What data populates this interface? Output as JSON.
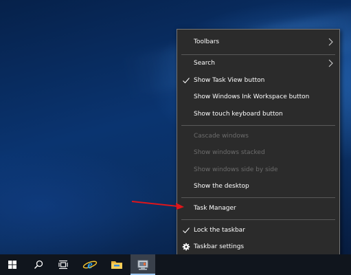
{
  "context_menu": {
    "items": [
      {
        "label": "Toolbars",
        "enabled": true,
        "checked": false,
        "submenu": true
      },
      {
        "label": "Search",
        "enabled": true,
        "checked": false,
        "submenu": true
      },
      {
        "label": "Show Task View button",
        "enabled": true,
        "checked": true
      },
      {
        "label": "Show Windows Ink Workspace button",
        "enabled": true,
        "checked": false
      },
      {
        "label": "Show touch keyboard button",
        "enabled": true,
        "checked": false
      },
      {
        "label": "Cascade windows",
        "enabled": false,
        "checked": false
      },
      {
        "label": "Show windows stacked",
        "enabled": false,
        "checked": false
      },
      {
        "label": "Show windows side by side",
        "enabled": false,
        "checked": false
      },
      {
        "label": "Show the desktop",
        "enabled": true,
        "checked": false
      },
      {
        "label": "Task Manager",
        "enabled": true,
        "checked": false
      },
      {
        "label": "Lock the taskbar",
        "enabled": true,
        "checked": true
      },
      {
        "label": "Taskbar settings",
        "enabled": true,
        "checked": false,
        "icon": "gear-icon"
      }
    ]
  },
  "taskbar": {
    "buttons": [
      {
        "name": "start-button",
        "icon": "windows-logo-icon"
      },
      {
        "name": "search-button",
        "icon": "search-icon"
      },
      {
        "name": "task-view-button",
        "icon": "task-view-icon"
      },
      {
        "name": "internet-explorer-button",
        "icon": "internet-explorer-icon"
      },
      {
        "name": "file-explorer-button",
        "icon": "folder-icon"
      },
      {
        "name": "server-manager-button",
        "icon": "server-manager-icon",
        "active": true
      }
    ]
  },
  "annotation": {
    "icon": "red-arrow-icon",
    "color": "#e0151a"
  },
  "colors": {
    "menu_bg": "#2b2b2b",
    "menu_text": "#ffffff",
    "disabled_text": "#6d6d6d",
    "taskbar_bg": "#10151d"
  }
}
